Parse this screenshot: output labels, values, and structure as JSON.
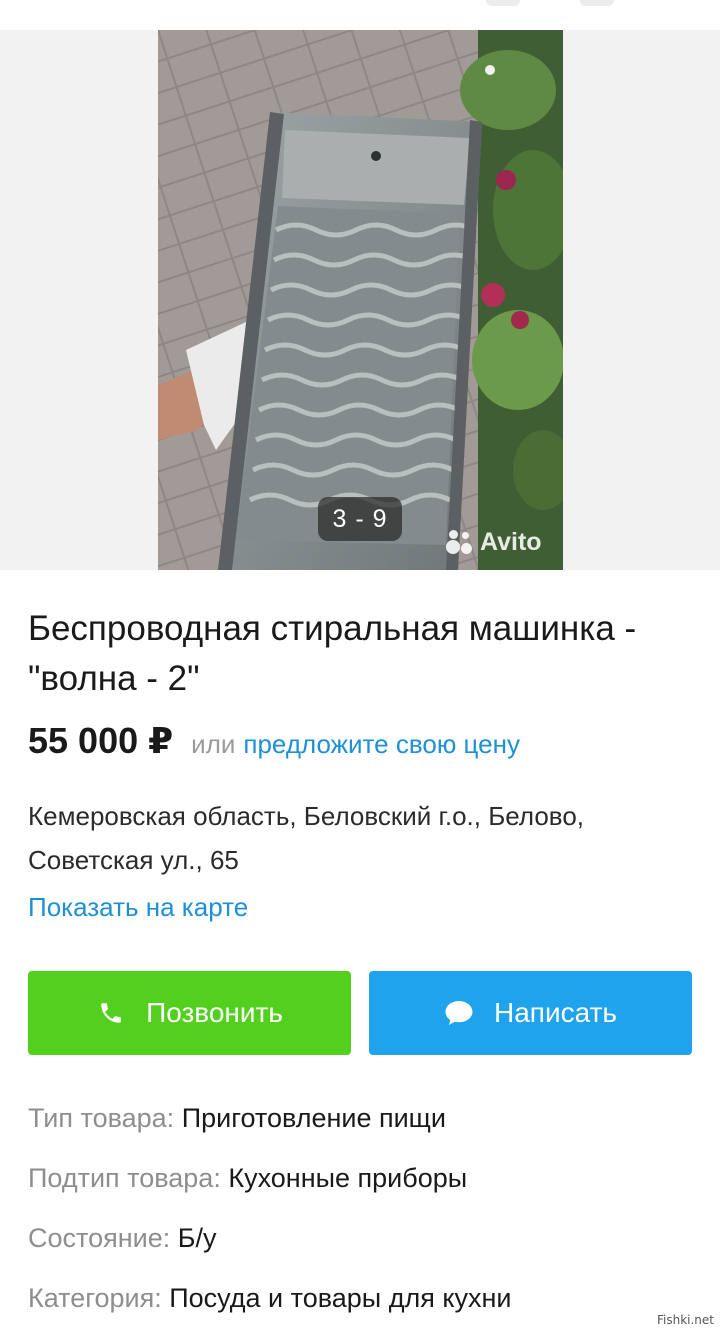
{
  "gallery": {
    "counter": "3 - 9",
    "watermark": "Avito"
  },
  "listing": {
    "title": "Беспроводная стиральная машинка - \"волна - 2\"",
    "price": "55 000 ₽",
    "price_or": "или",
    "price_offer_link": "предложите свою цену",
    "address": "Кемеровская область, Беловский г.о., Белово, Советская ул., 65",
    "map_link": "Показать на карте"
  },
  "actions": {
    "call_label": "Позвонить",
    "call_icon": "phone-icon",
    "write_label": "Написать",
    "write_icon": "chat-bubble-icon"
  },
  "params": [
    {
      "key": "Тип товара:",
      "value": "Приготовление пищи"
    },
    {
      "key": "Подтип товара:",
      "value": "Кухонные приборы"
    },
    {
      "key": "Состояние:",
      "value": "Б/у"
    },
    {
      "key": "Категория:",
      "value": "Посуда и товары для кухни"
    }
  ],
  "credit": "Fishki.net",
  "colors": {
    "call_button": "#52d01d",
    "write_button": "#1ea3ec",
    "link": "#1f90d6",
    "muted": "#8e8e8e"
  }
}
